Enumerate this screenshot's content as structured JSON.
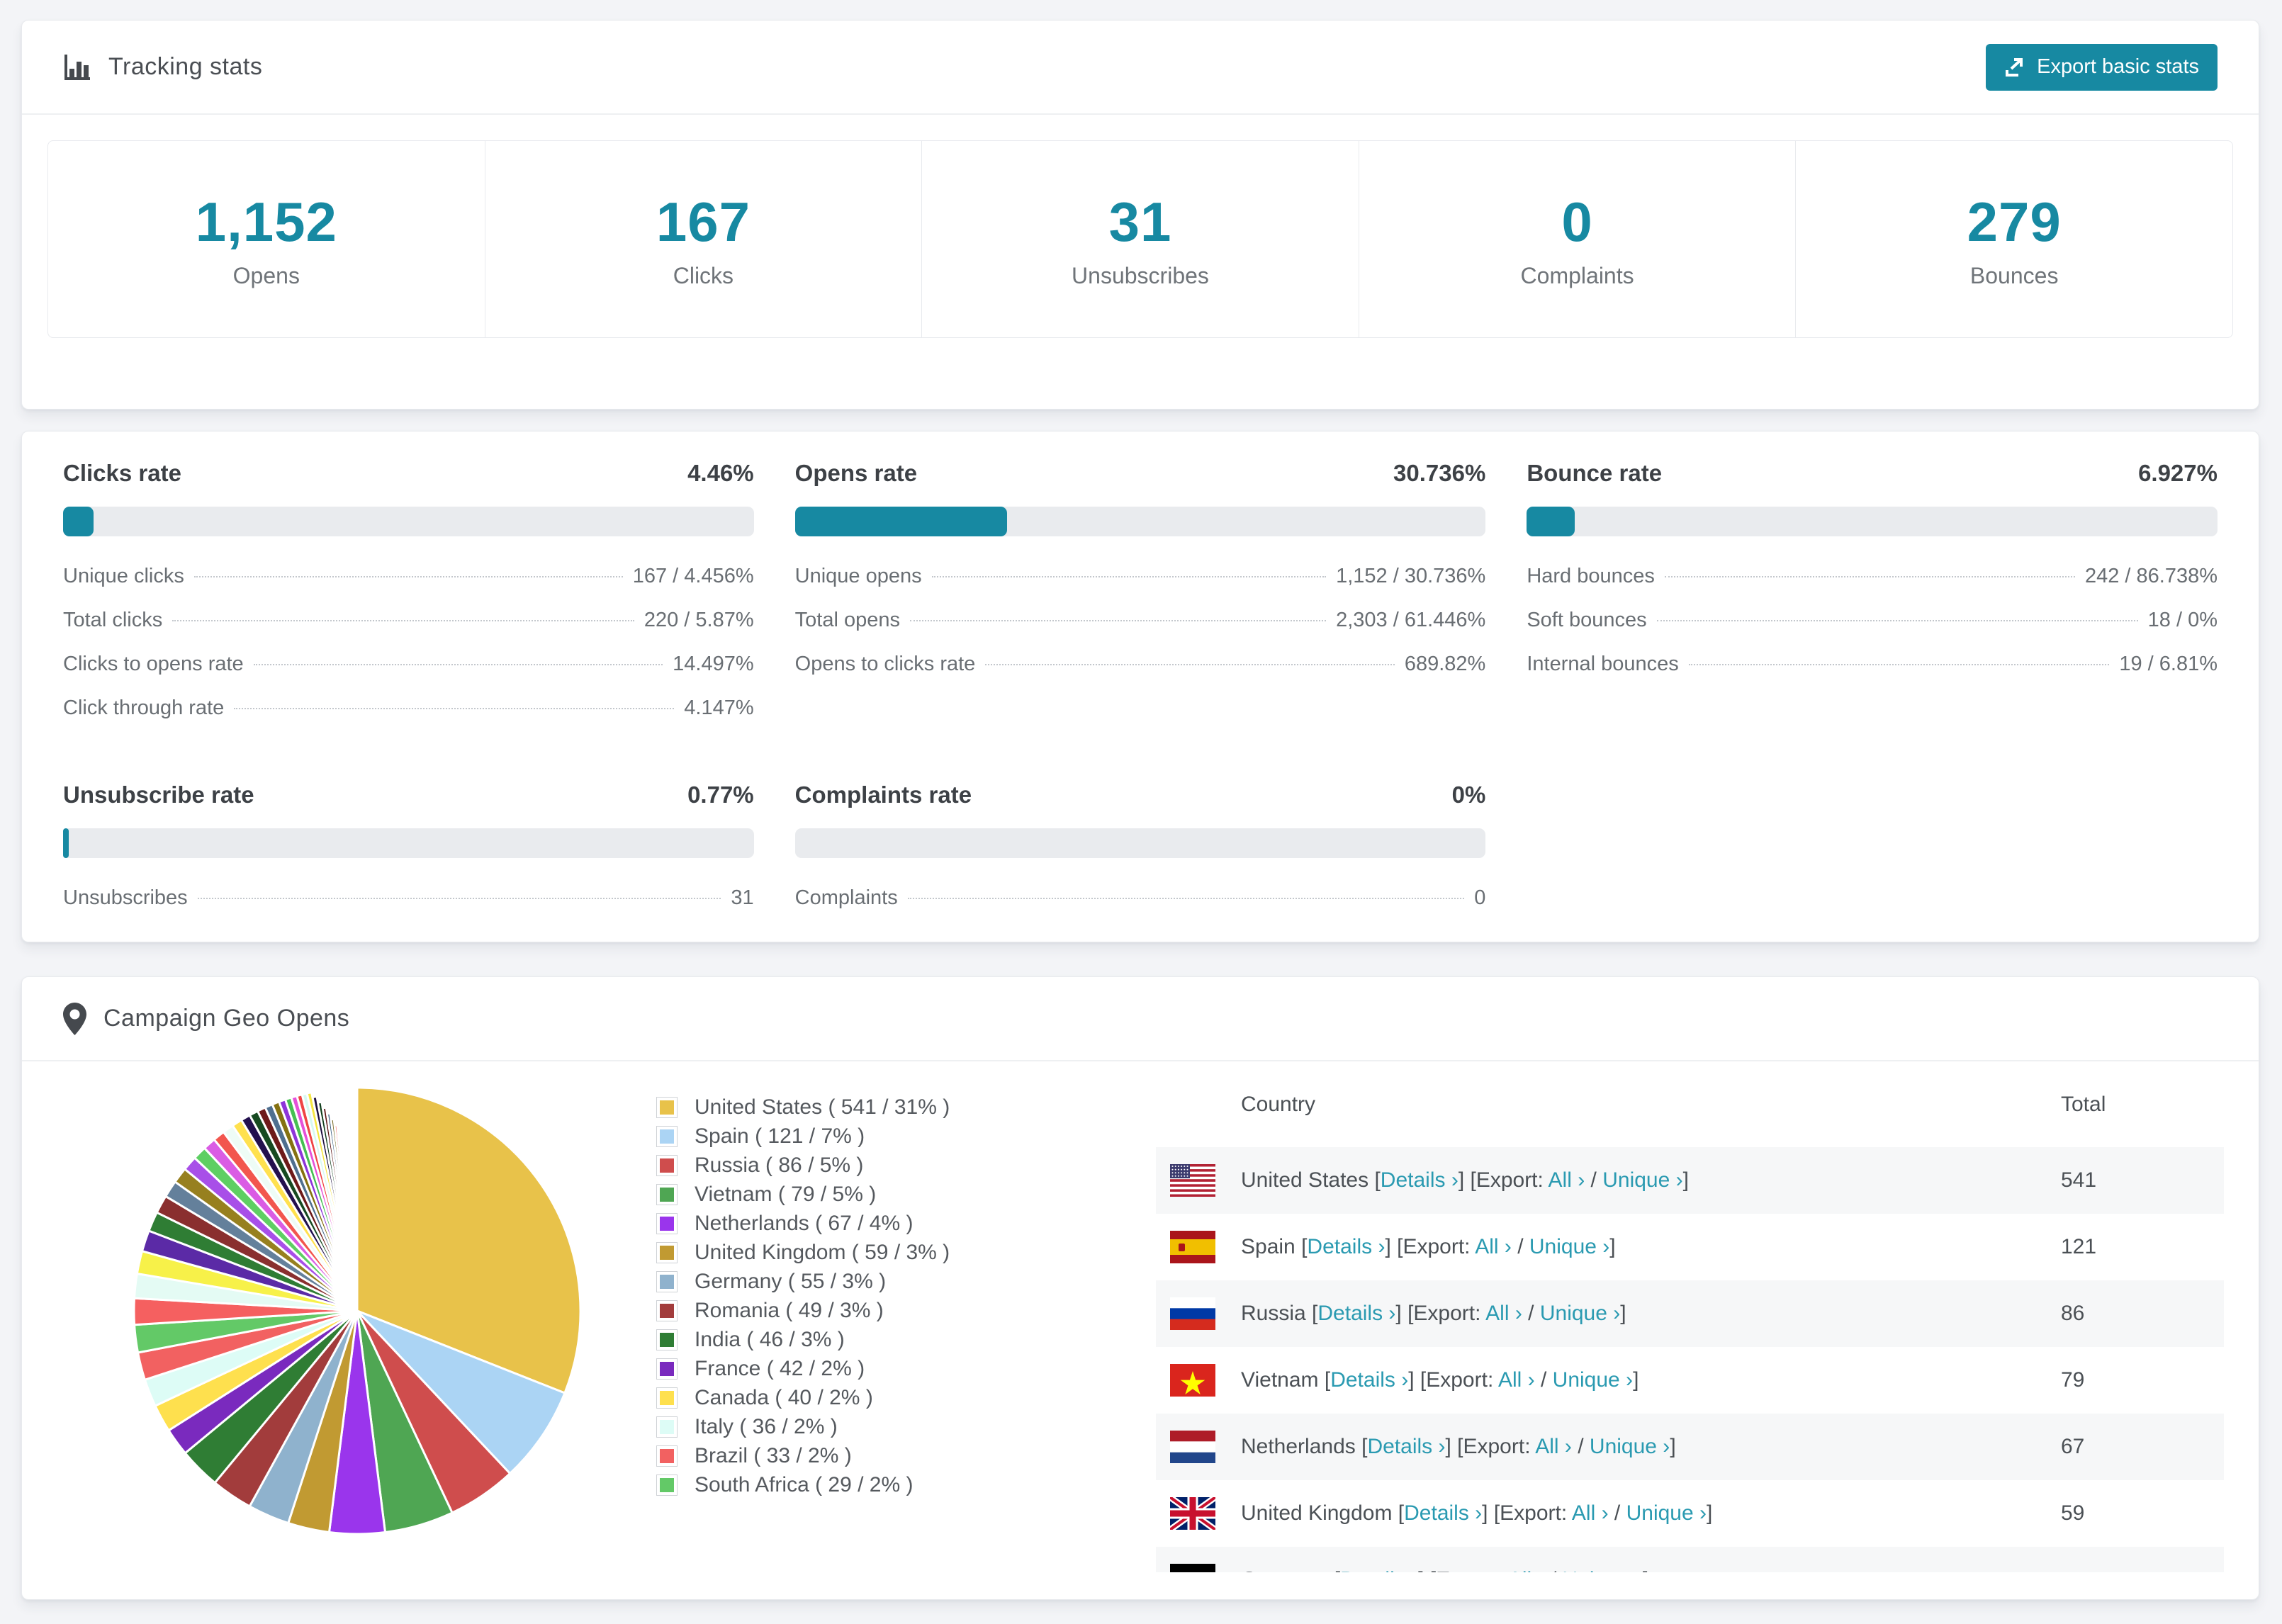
{
  "colors": {
    "accent": "#1789a2",
    "link": "#2a9ab1",
    "bar_track": "#e9ebee",
    "row_alt_bg": "#f6f7f8"
  },
  "tracking": {
    "title": "Tracking stats",
    "export_button": "Export basic stats",
    "stats": [
      {
        "value": "1,152",
        "label": "Opens"
      },
      {
        "value": "167",
        "label": "Clicks"
      },
      {
        "value": "31",
        "label": "Unsubscribes"
      },
      {
        "value": "0",
        "label": "Complaints"
      },
      {
        "value": "279",
        "label": "Bounces"
      }
    ]
  },
  "rates": [
    {
      "title": "Clicks rate",
      "value": "4.46%",
      "percent": 4.46,
      "rows": [
        {
          "label": "Unique clicks",
          "value": "167 / 4.456%"
        },
        {
          "label": "Total clicks",
          "value": "220 / 5.87%"
        },
        {
          "label": "Clicks to opens rate",
          "value": "14.497%"
        },
        {
          "label": "Click through rate",
          "value": "4.147%"
        }
      ]
    },
    {
      "title": "Opens rate",
      "value": "30.736%",
      "percent": 30.736,
      "rows": [
        {
          "label": "Unique opens",
          "value": "1,152 / 30.736%"
        },
        {
          "label": "Total opens",
          "value": "2,303 / 61.446%"
        },
        {
          "label": "Opens to clicks rate",
          "value": "689.82%"
        }
      ]
    },
    {
      "title": "Bounce rate",
      "value": "6.927%",
      "percent": 6.927,
      "rows": [
        {
          "label": "Hard bounces",
          "value": "242 / 86.738%"
        },
        {
          "label": "Soft bounces",
          "value": "18 / 0%"
        },
        {
          "label": "Internal bounces",
          "value": "19 / 6.81%"
        }
      ]
    },
    {
      "title": "Unsubscribe rate",
      "value": "0.77%",
      "percent": 0.77,
      "rows": [
        {
          "label": "Unsubscribes",
          "value": "31"
        }
      ]
    },
    {
      "title": "Complaints rate",
      "value": "0%",
      "percent": 0,
      "rows": [
        {
          "label": "Complaints",
          "value": "0"
        }
      ]
    }
  ],
  "geo": {
    "title": "Campaign Geo Opens",
    "chart_data": {
      "type": "pie",
      "title": "Campaign Geo Opens",
      "unit": "opens",
      "start_angle_deg": 0,
      "direction": "clockwise",
      "legend_position": "right",
      "slices": [
        {
          "label": "United States",
          "value": 541,
          "pct": 31,
          "color": "#e8c24a"
        },
        {
          "label": "Spain",
          "value": 121,
          "pct": 7,
          "color": "#abd4f4"
        },
        {
          "label": "Russia",
          "value": 86,
          "pct": 5,
          "color": "#cf4d4d"
        },
        {
          "label": "Vietnam",
          "value": 79,
          "pct": 5,
          "color": "#4fa653"
        },
        {
          "label": "Netherlands",
          "value": 67,
          "pct": 4,
          "color": "#9a35ec"
        },
        {
          "label": "United Kingdom",
          "value": 59,
          "pct": 3,
          "color": "#c19a32"
        },
        {
          "label": "Germany",
          "value": 55,
          "pct": 3,
          "color": "#8fb2cd"
        },
        {
          "label": "Romania",
          "value": 49,
          "pct": 3,
          "color": "#a23c3c"
        },
        {
          "label": "India",
          "value": 46,
          "pct": 3,
          "color": "#2f7d34"
        },
        {
          "label": "France",
          "value": 42,
          "pct": 2,
          "color": "#7a2abe"
        },
        {
          "label": "Canada",
          "value": 40,
          "pct": 2,
          "color": "#fee04e"
        },
        {
          "label": "Italy",
          "value": 36,
          "pct": 2,
          "color": "#ddfcf6"
        },
        {
          "label": "Brazil",
          "value": 33,
          "pct": 2,
          "color": "#f26161"
        },
        {
          "label": "South Africa",
          "value": 29,
          "pct": 2,
          "color": "#63c967"
        }
      ],
      "others_tail": {
        "note": "many small unlabeled country slices filling the remainder",
        "total_pct": 26,
        "palette": [
          "#f56060",
          "#e4fbf4",
          "#f7f149",
          "#5b2aa6",
          "#2f7d34",
          "#8a2f2f",
          "#64809b",
          "#97801f",
          "#a84fe8",
          "#5ecf63",
          "#da5ce4",
          "#f2564e",
          "#eefcf6",
          "#ffe14e",
          "#23104e",
          "#174a21",
          "#6e1a1a",
          "#4f6f8f",
          "#857111",
          "#8d35d9",
          "#46bf52",
          "#e551d8",
          "#ef4444",
          "#d7f9f0",
          "#f5e642",
          "#1d0f3c",
          "#0f3d1a",
          "#5c1313",
          "#3b5f80",
          "#6b5c0e"
        ]
      }
    },
    "legend_format": "{label} ( {value} / {pct}% )",
    "table": {
      "headers": [
        "Country",
        "Total"
      ],
      "link_labels": {
        "details": "Details",
        "export": "Export:",
        "all": "All",
        "unique": "Unique",
        "chevron": "›"
      },
      "rows": [
        {
          "country": "United States",
          "flag": "us",
          "total": "541"
        },
        {
          "country": "Spain",
          "flag": "es",
          "total": "121"
        },
        {
          "country": "Russia",
          "flag": "ru",
          "total": "86"
        },
        {
          "country": "Vietnam",
          "flag": "vn",
          "total": "79"
        },
        {
          "country": "Netherlands",
          "flag": "nl",
          "total": "67"
        },
        {
          "country": "United Kingdom",
          "flag": "gb",
          "total": "59"
        },
        {
          "country": "Germany",
          "flag": "de",
          "total": ""
        }
      ]
    }
  }
}
